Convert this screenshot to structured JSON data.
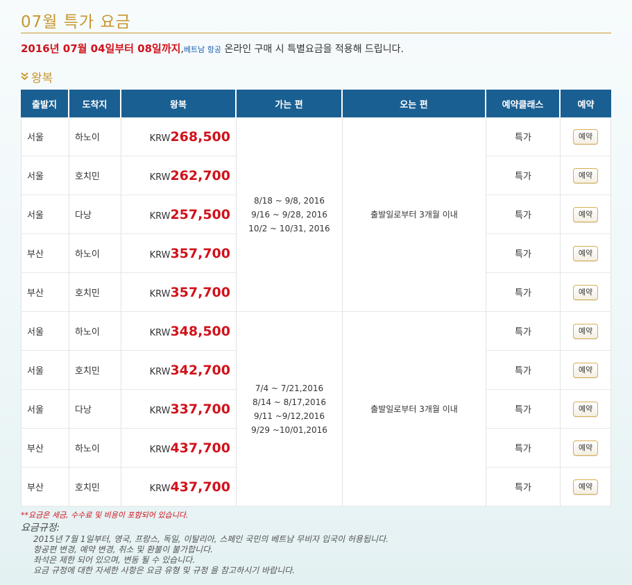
{
  "page": {
    "title": "07월 특가 요금",
    "subtitle": {
      "period": "2016년 07월 04일부터 08일까지",
      "comma": ",",
      "airline": "베트남 항공",
      "message": " 온라인 구매 시 특별요금을 적용해 드립니다."
    },
    "section_label": "왕복"
  },
  "table": {
    "headers": [
      "출발지",
      "도착지",
      "왕복",
      "가는 편",
      "오는 편",
      "예약클래스",
      "예약"
    ],
    "currency": "KRW",
    "book_label": "예약",
    "groups": [
      {
        "outbound_dates": [
          "8/18 ~ 9/8, 2016",
          "9/16 ~ 9/28, 2016",
          "10/2 ~ 10/31, 2016"
        ],
        "return_period": "출발일로부터 3개월 이내",
        "rows": [
          {
            "from": "서울",
            "to": "하노이",
            "price": "268,500",
            "class": "특가"
          },
          {
            "from": "서울",
            "to": "호치민",
            "price": "262,700",
            "class": "특가"
          },
          {
            "from": "서울",
            "to": "다낭",
            "price": "257,500",
            "class": "특가"
          },
          {
            "from": "부산",
            "to": "하노이",
            "price": "357,700",
            "class": "특가"
          },
          {
            "from": "부산",
            "to": "호치민",
            "price": "357,700",
            "class": "특가"
          }
        ]
      },
      {
        "outbound_dates": [
          "7/4 ~ 7/21,2016",
          "8/14 ~ 8/17,2016",
          "9/11 ~9/12,2016",
          "9/29 ~10/01,2016"
        ],
        "return_period": "출발일로부터 3개월 이내",
        "rows": [
          {
            "from": "서울",
            "to": "하노이",
            "price": "348,500",
            "class": "특가"
          },
          {
            "from": "서울",
            "to": "호치민",
            "price": "342,700",
            "class": "특가"
          },
          {
            "from": "서울",
            "to": "다낭",
            "price": "337,700",
            "class": "특가"
          },
          {
            "from": "부산",
            "to": "하노이",
            "price": "437,700",
            "class": "특가"
          },
          {
            "from": "부산",
            "to": "호치민",
            "price": "437,700",
            "class": "특가"
          }
        ]
      }
    ]
  },
  "notes": {
    "tax_note": "**요금은 세금, 수수료 및 비용이 포함되어 있습니다.",
    "rules_title": "요금규정:",
    "rules": [
      "2015년 7월 1일부터, 영국, 프랑스, 독일, 이탈리아, 스페인 국민의 베트남 무비자 입국이 허용됩니다.",
      "항공편 변경, 예약 변경, 취소 및 환불이 불가합니다.",
      "좌석은 제한 되어 있으며, 변동 될 수 있습니다.",
      "요금 규정에 대한 자세한 사항은 요금 유형 및 규정 을 참고하시기 바랍니다."
    ]
  },
  "colors": {
    "gold": "#c8962f",
    "header_blue": "#1a5f92",
    "price_red": "#d0121b",
    "link_blue": "#1a5fb0"
  }
}
